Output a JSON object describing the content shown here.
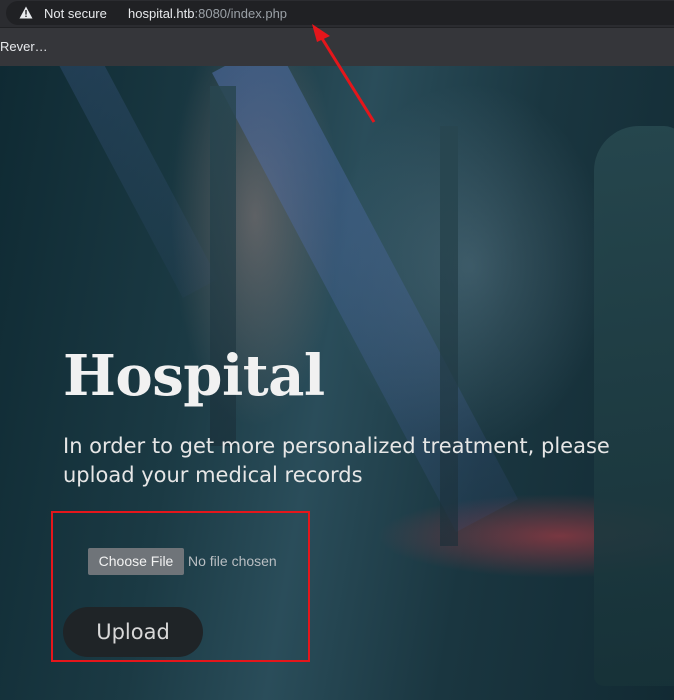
{
  "browser": {
    "security_label": "Not secure",
    "url_host": "hospital.htb",
    "url_rest": ":8080/index.php",
    "bookmark": "Rever…",
    "icons": {
      "security": "warning-triangle-icon"
    }
  },
  "page": {
    "title": "Hospital",
    "subtitle": "In order to get more personalized treatment, please upload your medical records",
    "file_button": "Choose File",
    "file_status": "No file chosen",
    "upload_button": "Upload"
  },
  "annotation": {
    "color": "#e5161b"
  }
}
